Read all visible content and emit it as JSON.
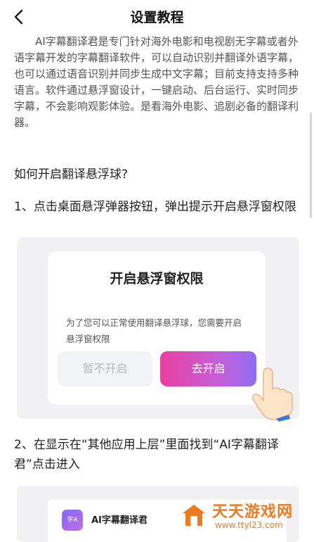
{
  "header": {
    "back_icon": "chevron-left-icon",
    "title": "设置教程"
  },
  "content": {
    "intro": "AI字幕翻译君是专门针对海外电影和电视剧无字幕或者外语字幕开发的字幕翻译软件，可以自动识别并翻译外语字幕，也可以通过语音识别并同步生成中文字幕；目前支持支持多种语言。软件通过悬浮窗设计，一键启动、后台运行、实时同步字幕，不会影响观影体验。是看海外电影、追剧必备的翻译利器。",
    "question": "如何开启翻译悬浮球?",
    "step1": "1、点击桌面悬浮弹器按钮，弹出提示开启悬浮窗权限",
    "step2": "2、在显示在“其他应用上层”里面找到“AI字幕翻译君”点击进入"
  },
  "dialog_example": {
    "title": "开启悬浮窗权限",
    "message": "为了您可以正常使用翻译悬浮球，您需要开启悬浮窗权限",
    "cancel_label": "暂不开启",
    "confirm_label": "去开启",
    "hand_icon": "pointing-hand-icon",
    "accent_gradient": [
      "#ea3fa1",
      "#8e6df2"
    ]
  },
  "app_list_example": {
    "app_icon_text": "字A",
    "app_name": "AI字幕翻译君"
  },
  "watermark": {
    "title": "天天游戏网",
    "url": "www.ttyl23.com",
    "color": "#f07a22"
  }
}
